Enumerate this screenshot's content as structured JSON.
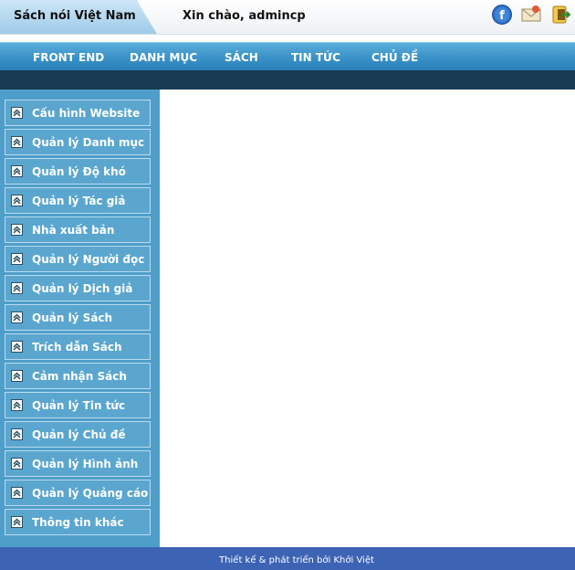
{
  "header": {
    "brand": "Sách nói Việt Nam",
    "greeting": "Xin chào, admincp",
    "icons": [
      "facebook-icon",
      "mail-icon",
      "logout-icon"
    ]
  },
  "nav": {
    "items": [
      "FRONT END",
      "DANH MỤC",
      "SÁCH",
      "TIN TỨC",
      "CHỦ ĐỀ"
    ]
  },
  "sidebar": {
    "items": [
      "Cấu hình Website",
      "Quản lý Danh mục",
      "Quản lý Độ khó",
      "Quản lý Tác giả",
      "Nhà xuất bản",
      "Quản lý Người đọc",
      "Quản lý Dịch giả",
      "Quản lý Sách",
      "Trích dẫn Sách",
      "Cảm nhận Sách",
      "Quản lý Tin tức",
      "Quản lý Chủ đề",
      "Quản lý Hình ảnh",
      "Quản lý Quảng cáo",
      "Thông tin khác"
    ]
  },
  "footer": {
    "text": "Thiết kế & phát triển bởi Khởi Việt"
  },
  "colors": {
    "nav_bg": "#3b93c8",
    "subbar_bg": "#173b53",
    "sidebar_bg": "#4f9ec9",
    "menu_item_bg": "#5aa6cf",
    "footer_bg": "#3d63b4"
  }
}
